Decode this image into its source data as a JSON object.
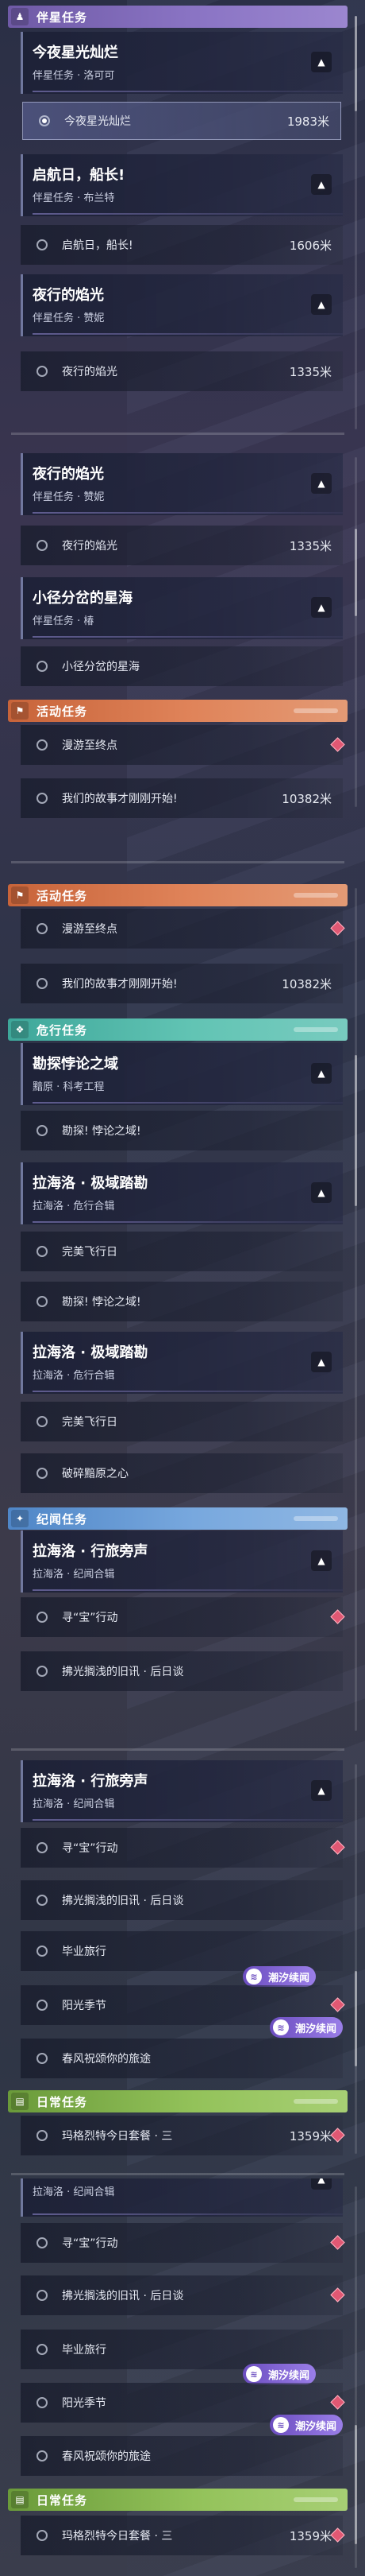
{
  "colors": {
    "companion": "#7f69b9",
    "event": "#d9744a",
    "danger": "#4fb5a6",
    "chronicle": "#6a9bd5",
    "daily": "#86b44c",
    "marker": "#e05873",
    "chip": "#7c5ccf"
  },
  "categories": {
    "companion": {
      "label": "伴星任务",
      "icon": "person-icon"
    },
    "event": {
      "label": "活动任务",
      "icon": "event-flag-icon"
    },
    "danger": {
      "label": "危行任务",
      "icon": "danger-icon"
    },
    "chronicle": {
      "label": "纪闻任务",
      "icon": "sparkle-icon"
    },
    "daily": {
      "label": "日常任务",
      "icon": "book-icon"
    }
  },
  "quests": {
    "tonight": {
      "title": "今夜星光灿烂",
      "sub": "伴星任务 · 洛可可",
      "step": "今夜星光灿烂",
      "dist": "1983米"
    },
    "setsail": {
      "title": "启航日，船长!",
      "sub": "伴星任务 · 布兰特",
      "step": "启航日，船长!",
      "dist": "1606米"
    },
    "flame": {
      "title": "夜行的焰光",
      "sub": "伴星任务 · 赞妮",
      "step": "夜行的焰光",
      "dist": "1335米"
    },
    "path": {
      "title": "小径分岔的星海",
      "sub": "伴星任务 · 椿",
      "step": "小径分岔的星海"
    },
    "drift": {
      "step": "漫游至终点"
    },
    "story": {
      "step": "我们的故事才刚刚开始!",
      "dist": "10382米"
    },
    "explore": {
      "title": "勘探悖论之域",
      "sub": "黯原 · 科考工程",
      "step": "勘探! 悖论之域!"
    },
    "lahai": {
      "title": "拉海洛 · 极域踏勘",
      "sub": "拉海洛 · 危行合辑",
      "step1": "完美飞行日",
      "step2": "勘探! 悖论之域!",
      "step3": "破碎黯原之心"
    },
    "bystander": {
      "title": "拉海洛 · 行旅旁声",
      "sub": "拉海洛 · 纪闻合辑",
      "s1": "寻“宝”行动",
      "s2": "拂光搁浅的旧讯 · 后日谈",
      "s3": "毕业旅行",
      "s4": "阳光季节",
      "s5": "春风祝颂你的旅途"
    },
    "daily": {
      "step": "玛格烈特今日套餐 · 三",
      "dist": "1359米"
    }
  },
  "chip": {
    "label": "潮汐续闻",
    "icon": "tide-icon"
  }
}
